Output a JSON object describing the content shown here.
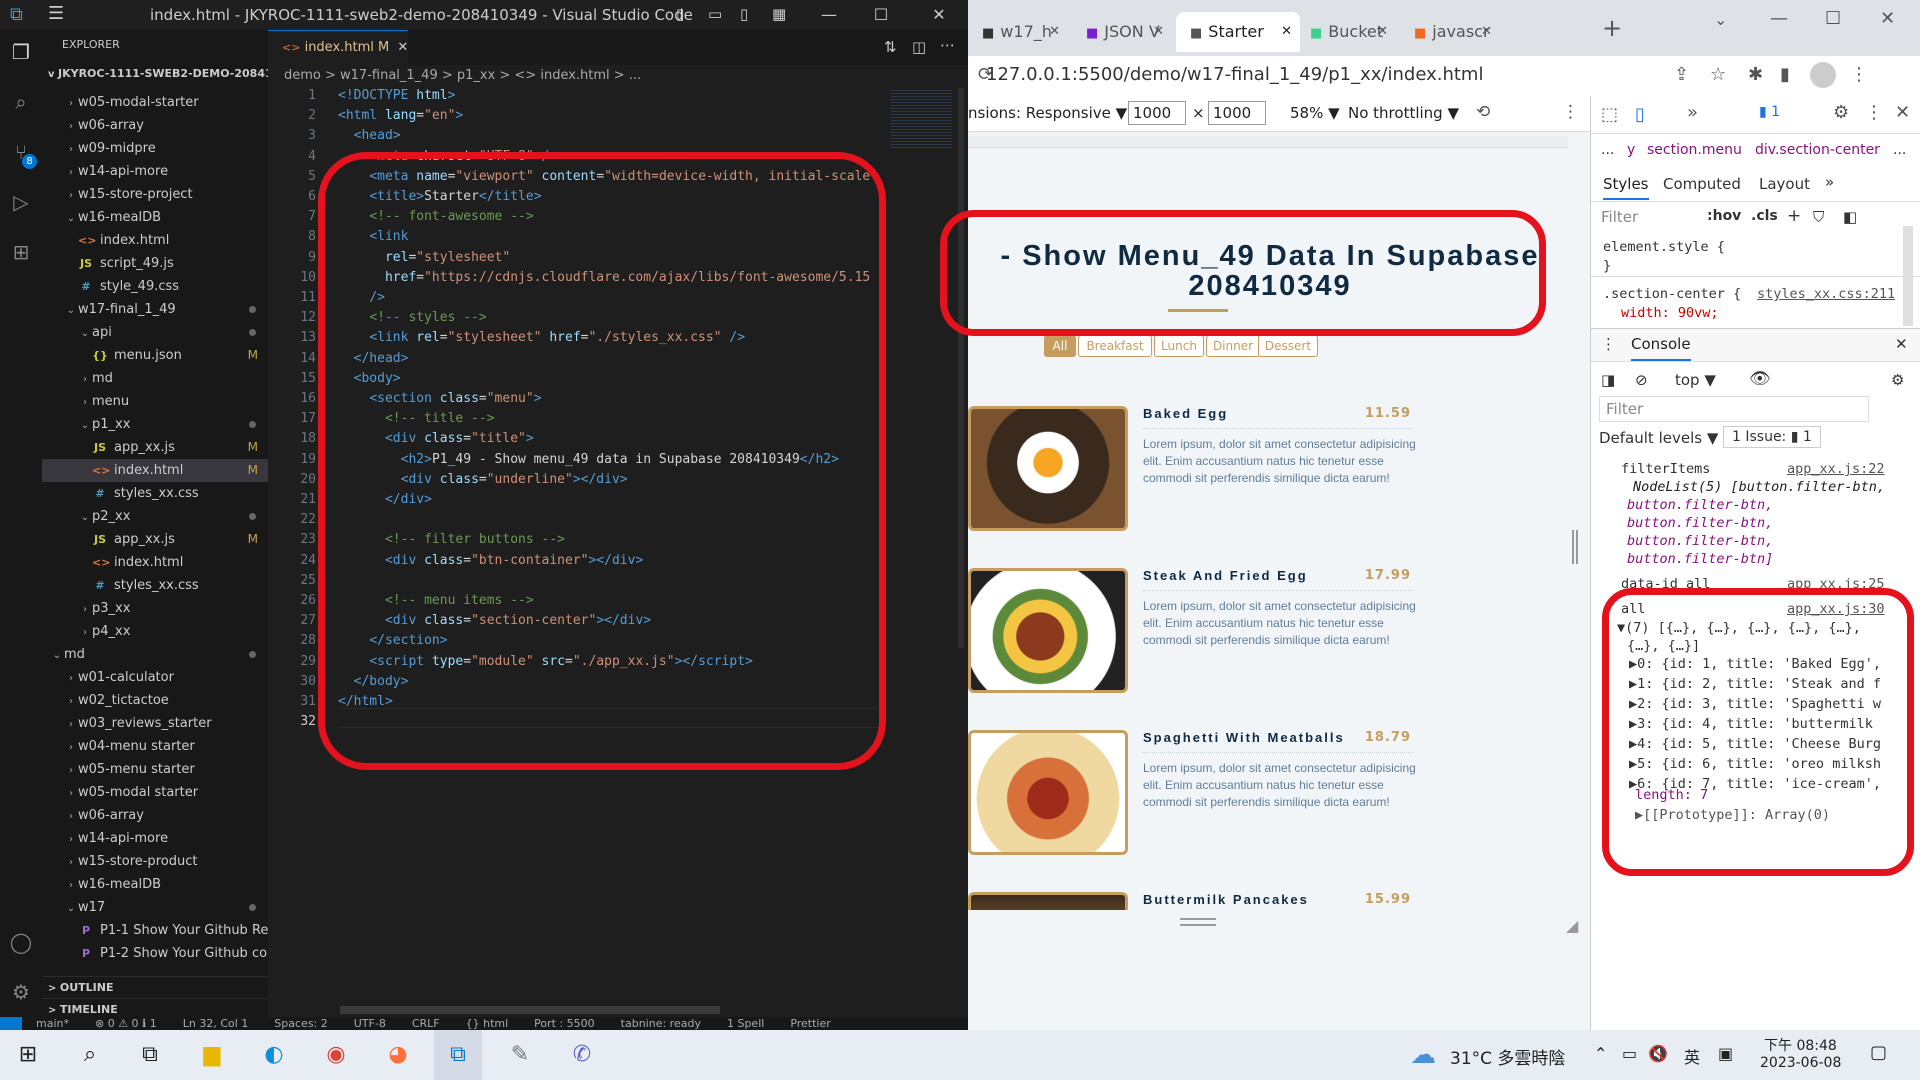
{
  "vscode": {
    "title": "index.html - JKYROC-1111-sweb2-demo-208410349 - Visual Studio Code",
    "explorer_label": "EXPLORER",
    "root": "JKYROC-1111-SWEB2-DEMO-20841...",
    "tree": [
      {
        "label": "w05-modal-starter",
        "chev": ">",
        "indent": 1
      },
      {
        "label": "w06-array",
        "chev": ">",
        "indent": 1
      },
      {
        "label": "w09-midpre",
        "chev": ">",
        "indent": 1
      },
      {
        "label": "w14-api-more",
        "chev": ">",
        "indent": 1
      },
      {
        "label": "w15-store-project",
        "chev": ">",
        "indent": 1
      },
      {
        "label": "w16-mealDB",
        "chev": "v",
        "indent": 1
      },
      {
        "label": "index.html",
        "icon": "html",
        "indent": 2
      },
      {
        "label": "script_49.js",
        "icon": "js",
        "indent": 2
      },
      {
        "label": "style_49.css",
        "icon": "css",
        "indent": 2
      },
      {
        "label": "w17-final_1_49",
        "chev": "v",
        "indent": 1,
        "dot": true
      },
      {
        "label": "api",
        "chev": "v",
        "indent": 2,
        "dot": true
      },
      {
        "label": "menu.json",
        "icon": "json",
        "indent": 3,
        "badge": "M"
      },
      {
        "label": "md",
        "chev": ">",
        "indent": 2
      },
      {
        "label": "menu",
        "chev": ">",
        "indent": 2
      },
      {
        "label": "p1_xx",
        "chev": "v",
        "indent": 2,
        "dot": true
      },
      {
        "label": "app_xx.js",
        "icon": "js",
        "indent": 3,
        "badge": "M"
      },
      {
        "label": "index.html",
        "icon": "html",
        "indent": 3,
        "badge": "M",
        "selected": true
      },
      {
        "label": "styles_xx.css",
        "icon": "css",
        "indent": 3
      },
      {
        "label": "p2_xx",
        "chev": "v",
        "indent": 2,
        "dot": true
      },
      {
        "label": "app_xx.js",
        "icon": "js",
        "indent": 3,
        "badge": "M"
      },
      {
        "label": "index.html",
        "icon": "html",
        "indent": 3
      },
      {
        "label": "styles_xx.css",
        "icon": "css",
        "indent": 3
      },
      {
        "label": "p3_xx",
        "chev": ">",
        "indent": 2
      },
      {
        "label": "p4_xx",
        "chev": ">",
        "indent": 2
      },
      {
        "label": "md",
        "chev": "v",
        "indent": 0,
        "dot": true
      },
      {
        "label": "w01-calculator",
        "chev": ">",
        "indent": 1
      },
      {
        "label": "w02_tictactoe",
        "chev": ">",
        "indent": 1
      },
      {
        "label": "w03_reviews_starter",
        "chev": ">",
        "indent": 1
      },
      {
        "label": "w04-menu starter",
        "chev": ">",
        "indent": 1
      },
      {
        "label": "w05-menu starter",
        "chev": ">",
        "indent": 1
      },
      {
        "label": "w05-modal starter",
        "chev": ">",
        "indent": 1
      },
      {
        "label": "w06-array",
        "chev": ">",
        "indent": 1
      },
      {
        "label": "w14-api-more",
        "chev": ">",
        "indent": 1
      },
      {
        "label": "w15-store-product",
        "chev": ">",
        "indent": 1
      },
      {
        "label": "w16-mealDB",
        "chev": ">",
        "indent": 1
      },
      {
        "label": "w17",
        "chev": "v",
        "indent": 1,
        "dot": true
      },
      {
        "label": "P1-1 Show Your Github Re...",
        "icon": "md",
        "indent": 2
      },
      {
        "label": "P1-2 Show Your Github co...",
        "icon": "md",
        "indent": 2
      }
    ],
    "outline_label": "OUTLINE",
    "timeline_label": "TIMELINE",
    "tab_label": "index.html",
    "tab_badge": "M",
    "breadcrumb": "demo > w17-final_1_49 > p1_xx > <> index.html > ...",
    "code_lines": [
      [
        [
          "tag",
          "<!DOCTYPE "
        ],
        [
          "attr",
          "html"
        ],
        [
          "tag",
          ">"
        ]
      ],
      [
        [
          "tag",
          "<html "
        ],
        [
          "attr",
          "lang"
        ],
        [
          "txt",
          "="
        ],
        [
          "str",
          "\"en\""
        ],
        [
          "tag",
          ">"
        ]
      ],
      [
        [
          "txt",
          "  "
        ],
        [
          "tag",
          "<head>"
        ]
      ],
      [
        [
          "txt",
          "    "
        ],
        [
          "tag",
          "<meta "
        ],
        [
          "attr",
          "charset"
        ],
        [
          "txt",
          "="
        ],
        [
          "str",
          "\"UTF-8\""
        ],
        [
          "tag",
          " />"
        ]
      ],
      [
        [
          "txt",
          "    "
        ],
        [
          "tag",
          "<meta "
        ],
        [
          "attr",
          "name"
        ],
        [
          "txt",
          "="
        ],
        [
          "str",
          "\"viewport\""
        ],
        [
          "txt",
          " "
        ],
        [
          "attr",
          "content"
        ],
        [
          "txt",
          "="
        ],
        [
          "str",
          "\"width=device-width, initial-scale"
        ]
      ],
      [
        [
          "txt",
          "    "
        ],
        [
          "tag",
          "<title>"
        ],
        [
          "txt",
          "Starter"
        ],
        [
          "tag",
          "</title>"
        ]
      ],
      [
        [
          "txt",
          "    "
        ],
        [
          "cmt",
          "<!-- font-awesome -->"
        ]
      ],
      [
        [
          "txt",
          "    "
        ],
        [
          "tag",
          "<link"
        ]
      ],
      [
        [
          "txt",
          "      "
        ],
        [
          "attr",
          "rel"
        ],
        [
          "txt",
          "="
        ],
        [
          "str",
          "\"stylesheet\""
        ]
      ],
      [
        [
          "txt",
          "      "
        ],
        [
          "attr",
          "href"
        ],
        [
          "txt",
          "="
        ],
        [
          "str",
          "\"https://cdnjs.cloudflare.com/ajax/libs/font-awesome/5.15"
        ]
      ],
      [
        [
          "txt",
          "    "
        ],
        [
          "tag",
          "/>"
        ]
      ],
      [
        [
          "txt",
          "    "
        ],
        [
          "cmt",
          "<!-- styles -->"
        ]
      ],
      [
        [
          "txt",
          "    "
        ],
        [
          "tag",
          "<link "
        ],
        [
          "attr",
          "rel"
        ],
        [
          "txt",
          "="
        ],
        [
          "str",
          "\"stylesheet\""
        ],
        [
          "txt",
          " "
        ],
        [
          "attr",
          "href"
        ],
        [
          "txt",
          "="
        ],
        [
          "str",
          "\"./styles_xx.css\""
        ],
        [
          "tag",
          " />"
        ]
      ],
      [
        [
          "txt",
          "  "
        ],
        [
          "tag",
          "</head>"
        ]
      ],
      [
        [
          "txt",
          "  "
        ],
        [
          "tag",
          "<body>"
        ]
      ],
      [
        [
          "txt",
          "    "
        ],
        [
          "tag",
          "<section "
        ],
        [
          "attr",
          "class"
        ],
        [
          "txt",
          "="
        ],
        [
          "str",
          "\"menu\""
        ],
        [
          "tag",
          ">"
        ]
      ],
      [
        [
          "txt",
          "      "
        ],
        [
          "cmt",
          "<!-- title -->"
        ]
      ],
      [
        [
          "txt",
          "      "
        ],
        [
          "tag",
          "<div "
        ],
        [
          "attr",
          "class"
        ],
        [
          "txt",
          "="
        ],
        [
          "str",
          "\"title\""
        ],
        [
          "tag",
          ">"
        ]
      ],
      [
        [
          "txt",
          "        "
        ],
        [
          "tag",
          "<h2>"
        ],
        [
          "txt",
          "P1_49 - Show menu_49 data in Supabase 208410349"
        ],
        [
          "tag",
          "</h2>"
        ]
      ],
      [
        [
          "txt",
          "        "
        ],
        [
          "tag",
          "<div "
        ],
        [
          "attr",
          "class"
        ],
        [
          "txt",
          "="
        ],
        [
          "str",
          "\"underline\""
        ],
        [
          "tag",
          "></div>"
        ]
      ],
      [
        [
          "txt",
          "      "
        ],
        [
          "tag",
          "</div>"
        ]
      ],
      [
        [
          "txt",
          ""
        ]
      ],
      [
        [
          "txt",
          "      "
        ],
        [
          "cmt",
          "<!-- filter buttons -->"
        ]
      ],
      [
        [
          "txt",
          "      "
        ],
        [
          "tag",
          "<div "
        ],
        [
          "attr",
          "class"
        ],
        [
          "txt",
          "="
        ],
        [
          "str",
          "\"btn-container\""
        ],
        [
          "tag",
          "></div>"
        ]
      ],
      [
        [
          "txt",
          ""
        ]
      ],
      [
        [
          "txt",
          "      "
        ],
        [
          "cmt",
          "<!-- menu items -->"
        ]
      ],
      [
        [
          "txt",
          "      "
        ],
        [
          "tag",
          "<div "
        ],
        [
          "attr",
          "class"
        ],
        [
          "txt",
          "="
        ],
        [
          "str",
          "\"section-center\""
        ],
        [
          "tag",
          "></div>"
        ]
      ],
      [
        [
          "txt",
          "    "
        ],
        [
          "tag",
          "</section>"
        ]
      ],
      [
        [
          "txt",
          "    "
        ],
        [
          "tag",
          "<script "
        ],
        [
          "attr",
          "type"
        ],
        [
          "txt",
          "="
        ],
        [
          "str",
          "\"module\""
        ],
        [
          "txt",
          " "
        ],
        [
          "attr",
          "src"
        ],
        [
          "txt",
          "="
        ],
        [
          "str",
          "\"./app_xx.js\""
        ],
        [
          "tag",
          "></"
        ],
        [
          "tag",
          "script>"
        ]
      ],
      [
        [
          "txt",
          "  "
        ],
        [
          "tag",
          "</body>"
        ]
      ],
      [
        [
          "tag",
          "</html>"
        ]
      ],
      [
        [
          "txt",
          ""
        ]
      ]
    ],
    "status_items": [
      "main*",
      "⊗ 0 ⚠ 0 ℹ 1",
      "Ln 32, Col 1",
      "Spaces: 2",
      "UTF-8",
      "CRLF",
      "{} html",
      "Port : 5500",
      "tabnine: ready",
      "1 Spell",
      "Prettier"
    ]
  },
  "browser": {
    "tabs": [
      "w17_h",
      "JSON V",
      "Starter",
      "Bucket",
      "javascr"
    ],
    "active_tab": 2,
    "url": "127.0.0.1:5500/demo/w17-final_1_49/p1_xx/index.html",
    "device_label": "nsions: Responsive ▼",
    "width": "1000",
    "height": "1000",
    "zoom": "58% ▼",
    "throttle": "No throttling ▼",
    "page": {
      "title_line1": "- Show Menu_49 Data In Supabase",
      "title_line2": "208410349",
      "filters": [
        "All",
        "Breakfast",
        "Lunch",
        "Dinner",
        "Dessert"
      ],
      "items": [
        {
          "name": "Baked Egg",
          "price": "11.59"
        },
        {
          "name": "Steak And Fried Egg",
          "price": "17.99"
        },
        {
          "name": "Spaghetti With Meatballs",
          "price": "18.79"
        },
        {
          "name": "Buttermilk Pancakes",
          "price": "15.99"
        }
      ],
      "desc": "Lorem ipsum, dolor sit amet consectetur adipisicing elit. Enim accusantium natus hic tenetur esse commodi sit perferendis similique dicta earum!"
    },
    "devtools": {
      "crumb": [
        "...",
        "y",
        "section.menu",
        "div.section-center",
        "..."
      ],
      "tabs": [
        "Styles",
        "Computed",
        "Layout",
        "»"
      ],
      "filter": "Filter",
      "hov": ":hov",
      "cls": ".cls",
      "style_rule1": "element.style {",
      "style_rule1_close": "}",
      "style_rule2": ".section-center {",
      "style_link": "styles_xx.css:211",
      "style_prop": "width: 90vw;",
      "console_label": "Console",
      "context": "top ▼",
      "con_filter": "Filter",
      "levels": "Default levels ▼",
      "issues": "1 Issue: ▮ 1",
      "log1_name": "filterItems",
      "log1_link": "app_xx.js:22",
      "log1_lines": [
        "NodeList(5) [button.filter-btn,",
        "button.filter-btn,",
        "button.filter-btn,",
        "button.filter-btn,",
        "button.filter-btn]"
      ],
      "log2_name": "data-id all",
      "log2_link": "app_xx.js:25",
      "log3_name": "all",
      "log3_link": "app_xx.js:30",
      "log3_head": "(7) [{…}, {…}, {…}, {…}, {…},",
      "log3_head2": "{…}, {…}]",
      "log3_items": [
        "▶0: {id: 1, title: 'Baked Egg',",
        "▶1: {id: 2, title: 'Steak and f",
        "▶2: {id: 3, title: 'Spaghetti w",
        "▶3: {id: 4, title: 'buttermilk",
        "▶4: {id: 5, title: 'Cheese Burg",
        "▶5: {id: 6, title: 'oreo milksh",
        "▶6: {id: 7, title: 'ice-cream',"
      ],
      "log3_len": "length: 7",
      "log3_proto": "▶[[Prototype]]: Array(0)"
    }
  },
  "taskbar": {
    "weather": "31°C 多雲時陰",
    "ime": "英",
    "time": "下午 08:48",
    "date": "2023-06-08"
  },
  "colors": {
    "annotation": "#e3121c",
    "accent": "#0078d4",
    "gold": "#c59d5f"
  }
}
